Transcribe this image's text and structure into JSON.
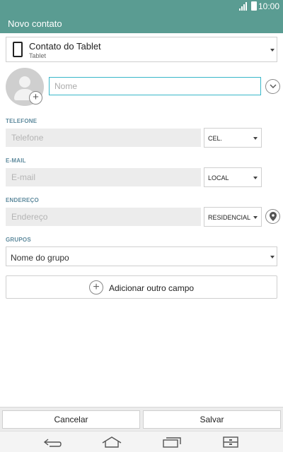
{
  "status_bar": {
    "time": "10:00",
    "icons": [
      "signal-icon",
      "battery-icon"
    ]
  },
  "header": {
    "title": "Novo contato"
  },
  "account": {
    "icon": "tablet-icon",
    "title": "Contato do Tablet",
    "subtitle": "Tablet"
  },
  "name": {
    "placeholder": "Nome"
  },
  "phone": {
    "section_label": "TELEFONE",
    "placeholder": "Telefone",
    "type": "CEL."
  },
  "email": {
    "section_label": "E-MAIL",
    "placeholder": "E-mail",
    "type": "LOCAL"
  },
  "address": {
    "section_label": "ENDEREÇO",
    "placeholder": "Endereço",
    "type": "RESIDENCIAL"
  },
  "groups": {
    "section_label": "GRUPOS",
    "value": "Nome do grupo"
  },
  "add_field": {
    "label": "Adicionar outro campo"
  },
  "actions": {
    "cancel": "Cancelar",
    "save": "Salvar"
  },
  "nav_bar": {
    "icons": [
      "back-icon",
      "home-icon",
      "recent-apps-icon",
      "dual-window-icon"
    ]
  },
  "colors": {
    "header": "#5a9c92",
    "accent": "#38b7c9",
    "section_label": "#5e8a9d"
  }
}
